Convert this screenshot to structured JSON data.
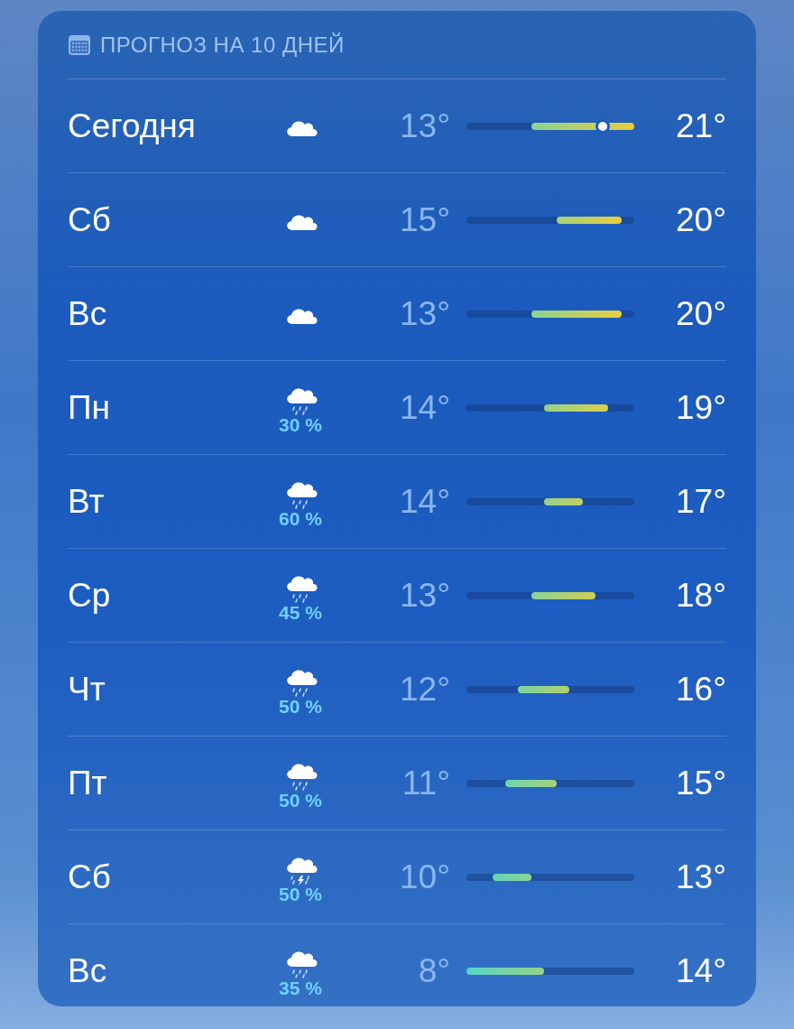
{
  "header": {
    "title": "ПРОГНОЗ НА 10 ДНЕЙ"
  },
  "days": [
    {
      "day": "Сегодня",
      "kind": "cloud",
      "low": "13°",
      "high": "21°",
      "level": 0.81
    },
    {
      "day": "Сб",
      "kind": "cloud",
      "low": "15°",
      "high": "20°"
    },
    {
      "day": "Вс",
      "kind": "cloud",
      "low": "13°",
      "high": "20°"
    },
    {
      "day": "Пн",
      "kind": "rain",
      "precip": "30 %",
      "low": "14°",
      "high": "19°"
    },
    {
      "day": "Вт",
      "kind": "rain",
      "precip": "60 %",
      "low": "14°",
      "high": "17°"
    },
    {
      "day": "Ср",
      "kind": "rain",
      "precip": "45 %",
      "low": "13°",
      "high": "18°"
    },
    {
      "day": "Чт",
      "kind": "rain",
      "precip": "50 %",
      "low": "12°",
      "high": "16°"
    },
    {
      "day": "Пт",
      "kind": "rain",
      "precip": "50 %",
      "low": "11°",
      "high": "15°"
    },
    {
      "day": "Сб",
      "kind": "thunder",
      "precip": "50 %",
      "low": "10°",
      "high": "13°"
    },
    {
      "day": "Вс",
      "kind": "rain",
      "precip": "35 %",
      "low": "8°",
      "high": "14°"
    }
  ]
}
